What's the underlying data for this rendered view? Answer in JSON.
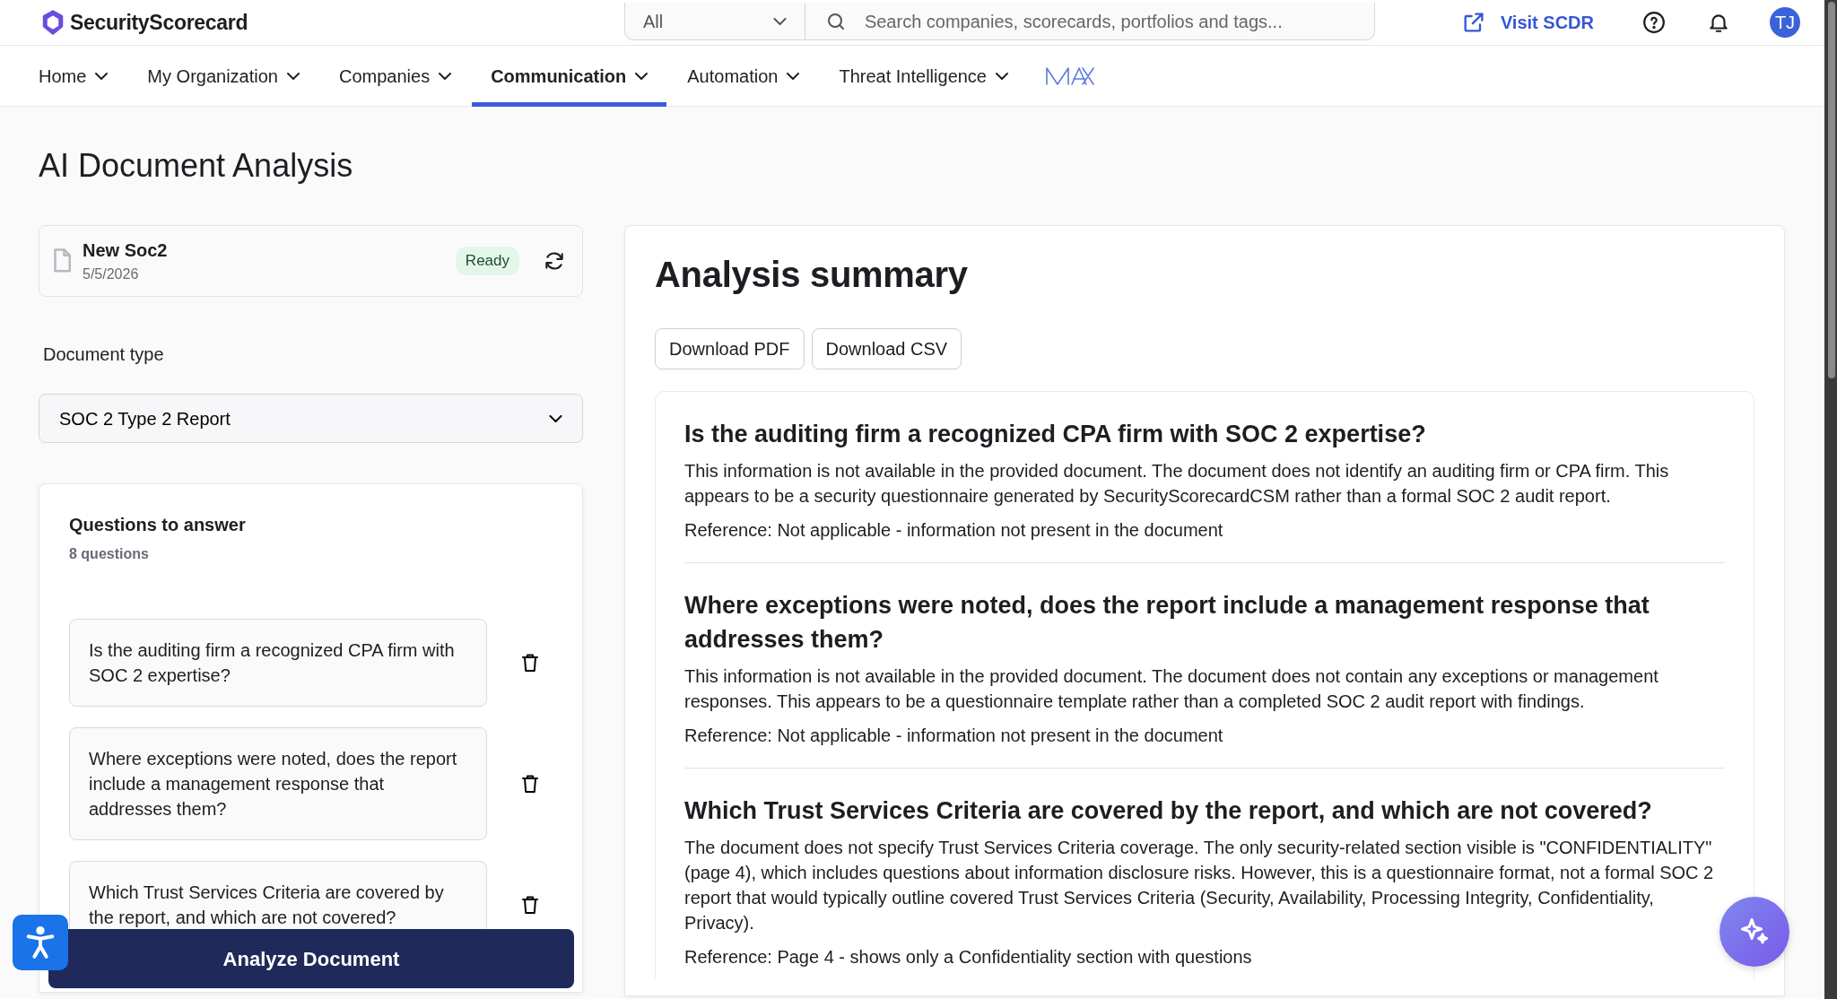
{
  "header": {
    "brand": "SecurityScorecard",
    "search_scope": "All",
    "search": {
      "placeholder": "Search companies, scorecards, portfolios and tags..."
    },
    "visit_link": "Visit SCDR",
    "avatar": "TJ"
  },
  "nav": [
    {
      "label": "Home",
      "selected": false
    },
    {
      "label": "My Organization",
      "selected": false
    },
    {
      "label": "Companies",
      "selected": false
    },
    {
      "label": "Communication",
      "selected": true
    },
    {
      "label": "Automation",
      "selected": false
    },
    {
      "label": "Threat Intelligence",
      "selected": false
    }
  ],
  "page_title": "AI Document Analysis",
  "document": {
    "name": "New Soc2",
    "date": "5/5/2026",
    "status": "Ready"
  },
  "document_type": {
    "label": "Document type",
    "value": "SOC 2 Type 2 Report"
  },
  "questions": {
    "title": "Questions to answer",
    "count": "8 questions",
    "items": [
      {
        "text": "Is the auditing firm a recognized CPA firm with SOC 2 expertise?"
      },
      {
        "text": "Where exceptions were noted, does the report include a management response that addresses them?"
      },
      {
        "text": "Which Trust Services Criteria are covered by the report, and which are not covered?"
      }
    ]
  },
  "analyze_button": "Analyze Document",
  "summary": {
    "title": "Analysis summary",
    "buttons": [
      "Download PDF",
      "Download CSV"
    ],
    "answers": [
      {
        "question": "Is the auditing firm a recognized CPA firm with SOC 2 expertise?",
        "answer": "This information is not available in the provided document. The document does not identify an auditing firm or CPA firm. This appears to be a security questionnaire generated by SecurityScorecardCSM rather than a formal SOC 2 audit report.",
        "reference": "Reference: Not applicable - information not present in the document"
      },
      {
        "question": "Where exceptions were noted, does the report include a management response that addresses them?",
        "answer": "This information is not available in the provided document. The document does not contain any exceptions or management responses. This appears to be a questionnaire template rather than a completed SOC 2 audit report with findings.",
        "reference": "Reference: Not applicable - information not present in the document"
      },
      {
        "question": "Which Trust Services Criteria are covered by the report, and which are not covered?",
        "answer": "The document does not specify Trust Services Criteria coverage. The only security-related section visible is \"CONFIDENTIALITY\" (page 4), which includes questions about information disclosure risks. However, this is a questionnaire format, not a formal SOC 2 report that would typically outline covered Trust Services Criteria (Security, Availability, Processing Integrity, Confidentiality, Privacy).",
        "reference": "Reference: Page 4 - shows only a Confidentiality section with questions"
      }
    ]
  }
}
